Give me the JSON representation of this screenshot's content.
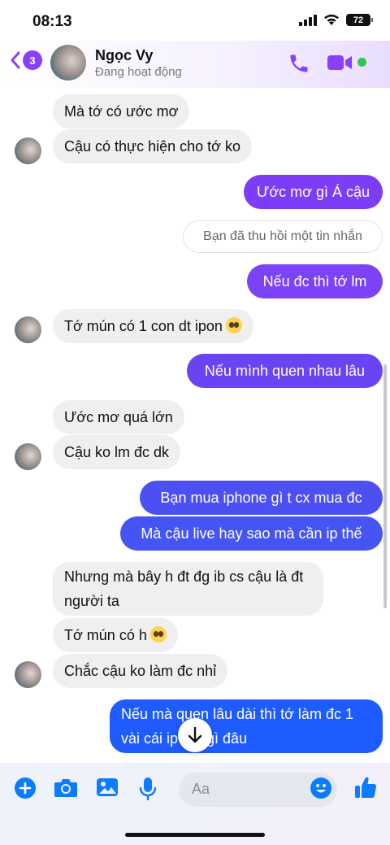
{
  "status_bar": {
    "time": "08:13",
    "battery": "72"
  },
  "header": {
    "back_badge_count": "3",
    "contact_name": "Ngọc Vy",
    "contact_status": "Đang hoạt động",
    "icons": [
      "back-chevron-icon",
      "phone-icon",
      "video-camera-icon",
      "online-dot"
    ]
  },
  "colors": {
    "accent": "#8a3ffc",
    "bubble_in": "#efefef",
    "bubble_out_top": "#7d3cf5",
    "bubble_out_bottom": "#1f5cff",
    "online": "#31c74d"
  },
  "messages": [
    {
      "from": "them",
      "text": "Mà tớ có ước mơ"
    },
    {
      "from": "them",
      "text": "Cậu có thực hiện cho tớ ko"
    },
    {
      "from": "me",
      "text": "Ước mơ gì Á cậu"
    },
    {
      "from": "system",
      "text": "Bạn đã thu hồi một tin nhắn"
    },
    {
      "from": "me",
      "text": "Nếu đc thì tớ lm"
    },
    {
      "from": "them",
      "text": "Tớ mún có 1 con dt ipon",
      "emoji": "pleading-face-icon"
    },
    {
      "from": "me",
      "text": "Nếu mình quen nhau lâu"
    },
    {
      "from": "them",
      "text": "Ước mơ quá lớn"
    },
    {
      "from": "them",
      "text": "Cậu ko lm đc dk"
    },
    {
      "from": "me",
      "text": "Bạn mua iphone gì t cx mua đc"
    },
    {
      "from": "me",
      "text": "Mà cậu live hay sao mà cần ip thế"
    },
    {
      "from": "them",
      "text": "Nhưng mà bây h đt đg ib cs cậu là đt người ta"
    },
    {
      "from": "them",
      "text": "Tớ mún có h",
      "emoji": "pleading-face-icon"
    },
    {
      "from": "them",
      "text": "Chắc cậu ko làm đc nhỉ"
    },
    {
      "from": "me",
      "text": "Nếu mà quen lâu dài thì tớ làm đc 1 vài cái ip mà gì đâu"
    }
  ],
  "composer": {
    "placeholder": "Aa",
    "icons": [
      "plus-icon",
      "camera-icon",
      "image-icon",
      "microphone-icon",
      "emoji-icon",
      "thumbs-up-icon"
    ]
  }
}
